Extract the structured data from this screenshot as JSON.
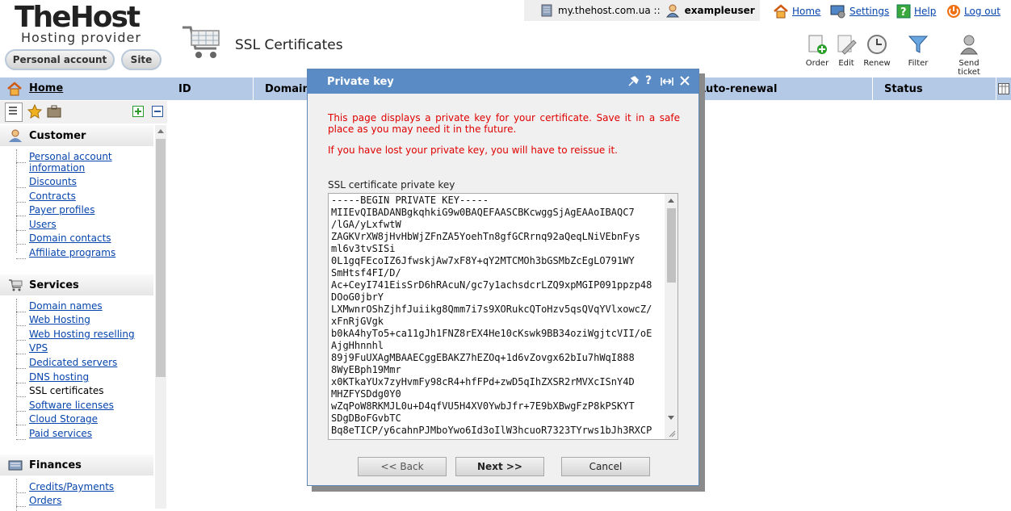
{
  "brand": {
    "logo": "TheHost",
    "tagline": "Hosting provider",
    "personal_account": "Personal account",
    "site": "Site"
  },
  "topbar": {
    "domain": "my.thehost.com.ua ::",
    "user": "exampleuser"
  },
  "toplinks": {
    "home": "Home",
    "settings": "Settings",
    "help": "Help",
    "logout": "Log out"
  },
  "page_title": "SSL Certificates",
  "toolbar": {
    "order": "Order",
    "edit": "Edit",
    "renew": "Renew",
    "filter": "Filter",
    "send_ticket": "Send ticket"
  },
  "sidebar": {
    "home": "Home",
    "customer": {
      "title": "Customer",
      "items": [
        "Personal account information",
        "Discounts",
        "Contracts",
        "Payer profiles",
        "Users",
        "Domain contacts",
        "Affiliate programs"
      ]
    },
    "services": {
      "title": "Services",
      "items": [
        "Domain names",
        "Web Hosting",
        "Web Hosting reselling",
        "VPS",
        "Dedicated servers",
        "DNS hosting",
        "SSL certificates",
        "Software licenses",
        "Cloud Storage",
        "Paid services"
      ]
    },
    "finances": {
      "title": "Finances",
      "items": [
        "Credits/Payments",
        "Orders"
      ]
    }
  },
  "table": {
    "columns": [
      "ID",
      "Domain",
      "Auto-renewal",
      "Status"
    ]
  },
  "dialog": {
    "title": "Private key",
    "info1": "This page displays a private key for your certificate. Save it in a safe place as you may need it in the future.",
    "info2": "If you have lost your private key, you will have to reissue it.",
    "key_label": "SSL certificate private key",
    "key_value": "-----BEGIN PRIVATE KEY-----\nMIIEvQIBADANBgkqhkiG9w0BAQEFAASCBKcwggSjAgEAAoIBAQC7\n/lGA/yLxfwtW\nZAGKVrXW8jHvHbWjZFnZA5YoehTn8gfGCRrnq92aQeqLNiVEbnFys\nml6v3tvSISi\n0L1gqFEcoIZ6JfwskjAw7xF8Y+qY2MTCMOh3bGSMbZcEgLO791WY\nSmHtsf4FI/D/\nAc+CeyI741EisSrD6hRAcuN/gc7y1achsdcrLZQ9xpMGIP091ppzp48\nDOoG0jbrY\nLXMwnrOShZjhfJuiikg8Qmm7i7s9XORukcQToHzv5qsQVqYVlxowcZ/\nxFnRjGVgk\nb0kA4hyTo5+ca11gJh1FNZ8rEX4He10cKswk9BB34oziWgjtcVII/oE\nAjgHhnnhl\n89j9FuUXAgMBAAECggEBAKZ7hEZOq+1d6vZovgx62bIu7hWqI888\n8WyEBph19Mmr\nx0KTkaYUx7zyHvmFy98cR4+hfFPd+zwD5qIhZXSR2rMVXcISnY4D\nMHZFYSDdg0Y0\nwZqPoW8RKMJL0u+D4qfVU5H4XV0YwbJfr+7E9bXBwgFzP8kPSKYT\nSDgDBoFGvbTC\nBq8eTICP/y6cahnPJMboYwo6Id3oIlW3hcuoR7323TYrws1bJh3RXCP",
    "back": "<< Back",
    "next": "Next >>",
    "cancel": "Cancel"
  }
}
